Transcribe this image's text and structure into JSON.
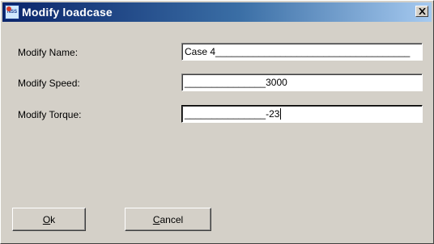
{
  "window": {
    "title": "Modify loadcase",
    "icon_text": "NSS",
    "close_symbol": "×"
  },
  "form": {
    "name_label": "Modify Name:",
    "name_value": "Case 4",
    "name_fill": "____________________________________",
    "speed_label": "Modify Speed:",
    "speed_fill": "_______________",
    "speed_value": "3000",
    "torque_label": "Modify Torque:",
    "torque_fill": "_______________",
    "torque_value": "-23"
  },
  "buttons": {
    "ok_mnemonic": "O",
    "ok_rest": "k",
    "cancel_mnemonic": "C",
    "cancel_rest": "ancel"
  },
  "colors": {
    "title_start": "#0a246a",
    "title_end": "#a6caf0",
    "dialog_bg": "#d4d0c8"
  }
}
